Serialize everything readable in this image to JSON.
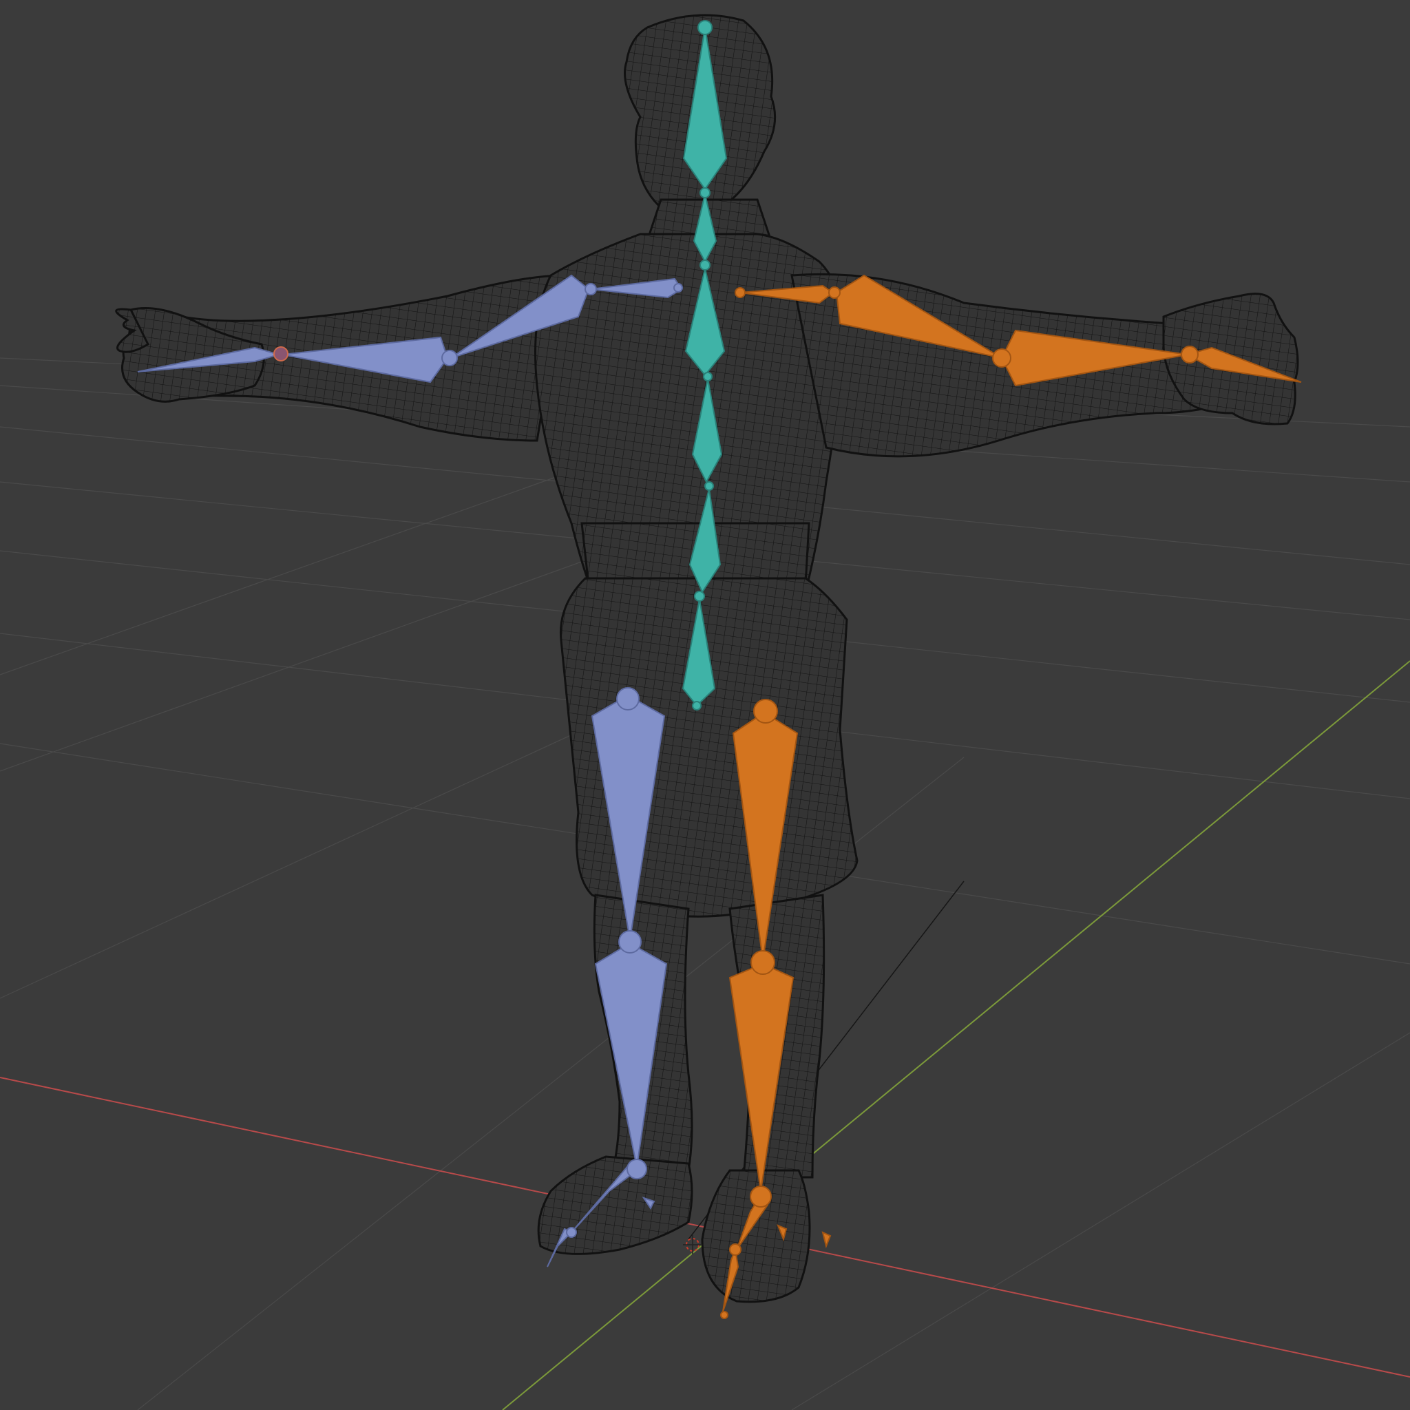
{
  "viewport": {
    "mode": "3d-viewport-wireframe",
    "background_color": "#3b3b3b",
    "grid_color": "#4a4a4a",
    "x_axis_color": "#b84a4a",
    "y_axis_color": "#7c9a3a"
  },
  "mesh": {
    "type": "humanoid-wireframe",
    "pose": "T-pose",
    "wire_color": "#111111",
    "fill_color": "#303030"
  },
  "armature": {
    "groups": [
      {
        "name": "spine",
        "color": "#3fb3a7",
        "edge_color": "#2a8179"
      },
      {
        "name": "left-side",
        "color": "#8290c9",
        "edge_color": "#5d6aa0"
      },
      {
        "name": "right-side",
        "color": "#d3741f",
        "edge_color": "#a35512"
      }
    ]
  },
  "scene": {
    "origin_marker": "3d-cursor-icon"
  }
}
